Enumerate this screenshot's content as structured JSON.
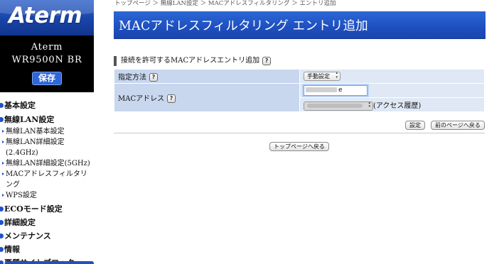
{
  "sidebar": {
    "logo": "Aterm",
    "model": "Aterm　WR9500N BR",
    "save_label": "保存",
    "menu": [
      {
        "type": "top",
        "label": "基本設定"
      },
      {
        "type": "top",
        "label": "無線LAN設定"
      },
      {
        "type": "sub",
        "label": "無線LAN基本設定"
      },
      {
        "type": "sub",
        "label": "無線LAN詳細設定(2.4GHz)"
      },
      {
        "type": "sub",
        "label": "無線LAN詳細設定(5GHz)"
      },
      {
        "type": "sub",
        "label": "MACアドレスフィルタリング"
      },
      {
        "type": "sub",
        "label": "WPS設定"
      },
      {
        "type": "top",
        "label": "ECOモード設定"
      },
      {
        "type": "top",
        "label": "詳細設定"
      },
      {
        "type": "top",
        "label": "メンテナンス"
      },
      {
        "type": "top",
        "label": "情報"
      },
      {
        "type": "top",
        "label": "悪質サイトブロック"
      }
    ]
  },
  "breadcrumb": "トップページ ＞ 無線LAN設定 ＞ MACアドレスフィルタリング ＞ エントリ追加",
  "page_title": "MACアドレスフィルタリング エントリ追加",
  "section_header": "接続を許可するMACアドレスエントリ追加",
  "help_label": "?",
  "form": {
    "method_label": "指定方法",
    "method_value": "手動設定",
    "mac_label": "MACアドレス",
    "mac_value_tail": "e",
    "history_label": "(アクセス履歴)"
  },
  "buttons": {
    "set": "設定",
    "prev_page": "前のページへ戻る",
    "top_page": "トップページへ戻る"
  },
  "colors": {
    "accent": "#1e4fbf",
    "label_cell": "#c8d6ee",
    "value_cell": "#dfe8f4"
  }
}
